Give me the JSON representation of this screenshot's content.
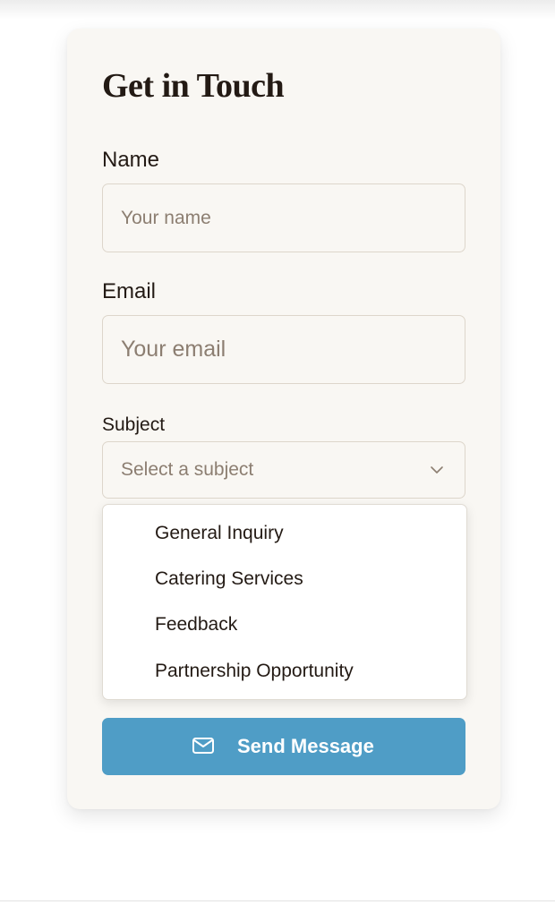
{
  "form": {
    "title": "Get in Touch",
    "name": {
      "label": "Name",
      "placeholder": "Your name",
      "value": ""
    },
    "email": {
      "label": "Email",
      "placeholder": "Your email",
      "value": ""
    },
    "subject": {
      "label": "Subject",
      "placeholder": "Select a subject",
      "icon": "chevron-down-icon",
      "options": [
        {
          "label": "General Inquiry"
        },
        {
          "label": "Catering Services"
        },
        {
          "label": "Feedback"
        },
        {
          "label": "Partnership Opportunity"
        }
      ]
    },
    "submit": {
      "label": "Send Message",
      "icon": "mail-icon"
    }
  },
  "colors": {
    "card_background": "#f9f7f3",
    "text": "#231a14",
    "placeholder": "#8c7e71",
    "border": "#ddd6cb",
    "accent": "#4f9dc6"
  }
}
